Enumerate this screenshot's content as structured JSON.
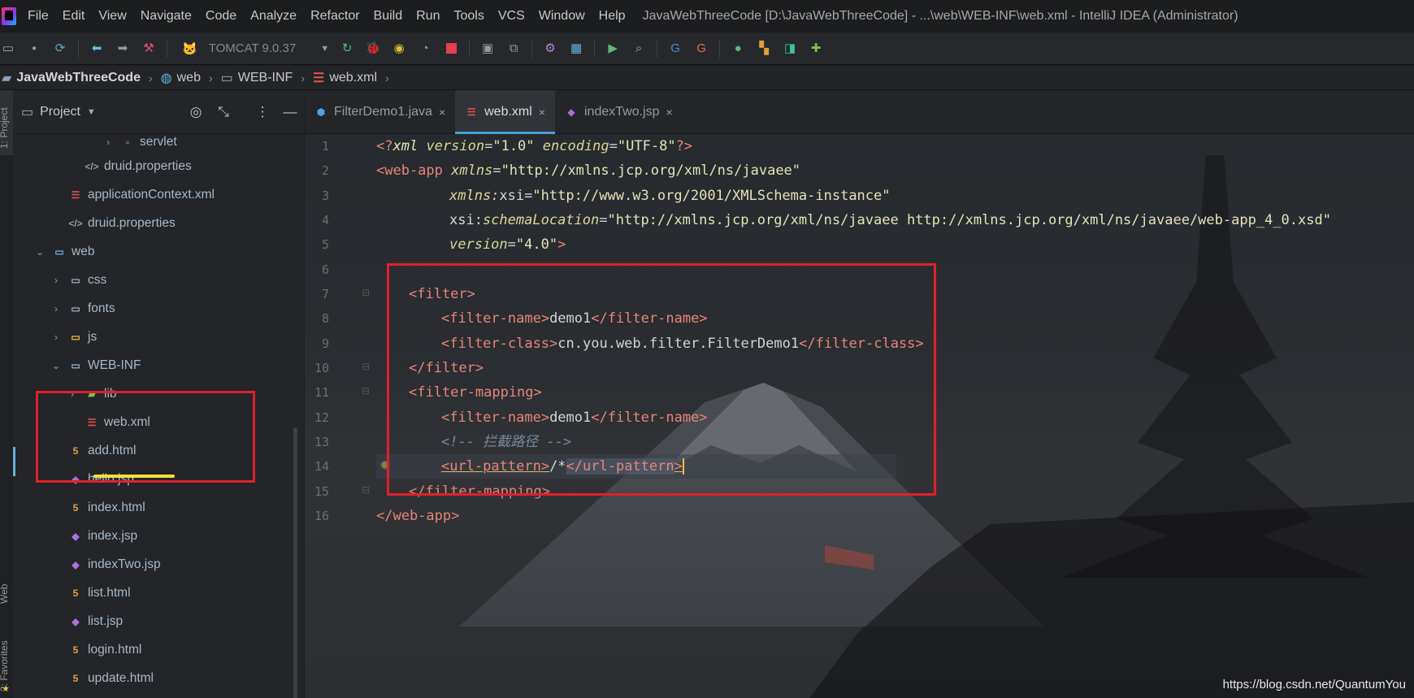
{
  "app": {
    "window_title": "JavaWebThreeCode [D:\\JavaWebThreeCode] - ...\\web\\WEB-INF\\web.xml - IntelliJ IDEA (Administrator)"
  },
  "menu": {
    "items": [
      "File",
      "Edit",
      "View",
      "Navigate",
      "Code",
      "Analyze",
      "Refactor",
      "Build",
      "Run",
      "Tools",
      "VCS",
      "Window",
      "Help"
    ]
  },
  "toolbar": {
    "run_config": "TOMCAT 9.0.37"
  },
  "breadcrumb": {
    "items": [
      "JavaWebThreeCode",
      "web",
      "WEB-INF",
      "web.xml"
    ]
  },
  "left_strip": {
    "project_label": "1: Project",
    "web_label": "Web",
    "favorites_label": "2: Favorites"
  },
  "project_panel": {
    "title": "Project",
    "tree": [
      {
        "label": "servlet",
        "icon": "package-icon"
      },
      {
        "label": "druid.properties",
        "icon": "properties-icon"
      },
      {
        "label": "applicationContext.xml",
        "icon": "xml-icon"
      },
      {
        "label": "druid.properties",
        "icon": "properties-icon"
      },
      {
        "label": "web",
        "icon": "web-folder-icon"
      },
      {
        "label": "css",
        "icon": "folder-icon"
      },
      {
        "label": "fonts",
        "icon": "folder-icon"
      },
      {
        "label": "js",
        "icon": "js-folder-icon"
      },
      {
        "label": "WEB-INF",
        "icon": "folder-icon"
      },
      {
        "label": "lib",
        "icon": "library-folder-icon"
      },
      {
        "label": "web.xml",
        "icon": "xml-icon"
      },
      {
        "label": "add.html",
        "icon": "html-icon"
      },
      {
        "label": "hello.jsp",
        "icon": "jsp-icon"
      },
      {
        "label": "index.html",
        "icon": "html-icon"
      },
      {
        "label": "index.jsp",
        "icon": "jsp-icon"
      },
      {
        "label": "indexTwo.jsp",
        "icon": "jsp-icon"
      },
      {
        "label": "list.html",
        "icon": "html-icon"
      },
      {
        "label": "list.jsp",
        "icon": "jsp-icon"
      },
      {
        "label": "login.html",
        "icon": "html-icon"
      },
      {
        "label": "update.html",
        "icon": "html-icon"
      }
    ]
  },
  "editor": {
    "tabs": [
      {
        "label": "FilterDemo1.java",
        "icon": "java-class-icon",
        "active": false
      },
      {
        "label": "web.xml",
        "icon": "xml-icon",
        "active": true
      },
      {
        "label": "indexTwo.jsp",
        "icon": "jsp-icon",
        "active": false
      }
    ],
    "line_numbers": [
      "1",
      "2",
      "3",
      "4",
      "5",
      "6",
      "7",
      "8",
      "9",
      "10",
      "11",
      "12",
      "13",
      "14",
      "15",
      "16"
    ],
    "code": {
      "l1_decl": "<?xml version=\"1.0\" encoding=\"UTF-8\"?>",
      "l1_a": "<?",
      "l1_b": "xml",
      "l1_c": " version",
      "l1_d": "=",
      "l1_e": "\"1.0\"",
      "l1_f": " encoding",
      "l1_g": "\"UTF-8\"",
      "l1_h": "?>",
      "l2_open": "<web-app",
      "l2_attr": " xmlns",
      "l2_val": "\"http://xmlns.jcp.org/xml/ns/javaee\"",
      "l3_ns": "xmlns:",
      "l3_attr": "xsi",
      "l3_val": "\"http://www.w3.org/2001/XMLSchema-instance\"",
      "l4_ns": "xsi:",
      "l4_attr": "schemaLocation",
      "l4_val": "\"http://xmlns.jcp.org/xml/ns/javaee http://xmlns.jcp.org/xml/ns/javaee/web-app_4_0.xsd\"",
      "l5_attr": "version",
      "l5_val": "\"4.0\"",
      "l5_close": ">",
      "filter_open": "<filter>",
      "filter_name_open": "<filter-name>",
      "filter_name_val": "demo1",
      "filter_name_close": "</filter-name>",
      "filter_class_open": "<filter-class>",
      "filter_class_val": "cn.you.web.filter.FilterDemo1",
      "filter_class_close": "</filter-class>",
      "filter_close": "</filter>",
      "mapping_open": "<filter-mapping>",
      "comment": "<!-- 拦截路径 -->",
      "url_open": "<url-pattern>",
      "url_val": "/*",
      "url_close_a": "</url-pattern",
      "url_close_b": ">",
      "mapping_close": "</filter-mapping>",
      "webapp_close": "</web-app>",
      "eq": "="
    }
  },
  "watermark": "https://blog.csdn.net/QuantumYou",
  "colors": {
    "highlight_box": "#e0202a",
    "underline": "#f6e23a",
    "tag": "#e8857a",
    "attr": "#d8d898",
    "active_tab_indicator": "#4a9fd8"
  }
}
